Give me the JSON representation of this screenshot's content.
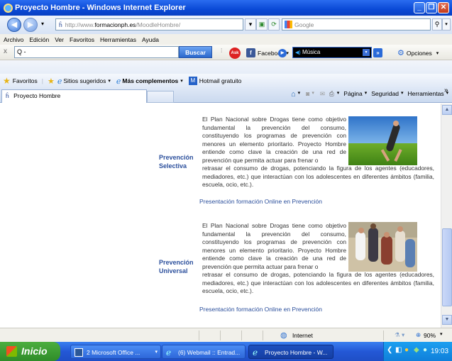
{
  "window": {
    "title": "Proyecto Hombre - Windows Internet Explorer"
  },
  "address_bar": {
    "url_prefix": "http://www.",
    "url_domain": "formacionph.es",
    "url_path": "/MoodleHombre/",
    "search_placeholder": "Google"
  },
  "menu": {
    "items": [
      "Archivo",
      "Edición",
      "Ver",
      "Favoritos",
      "Herramientas",
      "Ayuda"
    ]
  },
  "toolbar": {
    "search_value": "Q -",
    "buscar_label": "Buscar",
    "facebook_label": "Facebook",
    "musica_label": "Música",
    "opciones_label": "Opciones"
  },
  "favorites": {
    "favoritos_label": "Favoritos",
    "sitios_label": "Sitios sugeridos",
    "complementos_label": "Más complementos",
    "hotmail_label": "Hotmail gratuito"
  },
  "tab": {
    "title": "Proyecto Hombre"
  },
  "command_bar": {
    "pagina": "Página",
    "seguridad": "Seguridad",
    "herramientas": "Herramientas"
  },
  "sections": [
    {
      "title_line1": "Prevención",
      "title_line2": "Selectiva",
      "text": "El Plan Nacional sobre Drogas tiene como objetivo fundamental la prevención del consumo, constituyendo los programas de prevención con menores un elemento prioritario. Proyecto Hombre entiende como clave la creación de una red de prevención que permita actuar para frenar o retrasar el consumo de drogas, potenciando la figura de los agentes (educadores, mediadores, etc.) que interactúan con los adolescentes en diferentes ámbitos (familia, escuela, ocio, etc.).",
      "link": "Presentación formación Online en Prevención"
    },
    {
      "title_line1": "Prevención",
      "title_line2": "Universal",
      "text": "El Plan Nacional sobre Drogas tiene como objetivo fundamental la prevención del consumo, constituyendo los programas de prevención con menores un elemento prioritario. Proyecto Hombre entiende como clave la creación de una red de prevención que permita actuar para frenar o retrasar el consumo de drogas, potenciando la figura de los agentes (educadores, mediadores, etc.) que interactúan con los adolescentes en diferentes ámbitos (familia, escuela, ocio, etc.).",
      "link": "Presentación formación Online en Prevención"
    }
  ],
  "status": {
    "zone": "Internet",
    "zoom": "90%"
  },
  "taskbar": {
    "start_label": "Inicio",
    "tasks": [
      "2 Microsoft Office ...",
      "(6) Webmail :: Entrad...",
      "Proyecto Hombre - W..."
    ],
    "clock": "19:03"
  }
}
